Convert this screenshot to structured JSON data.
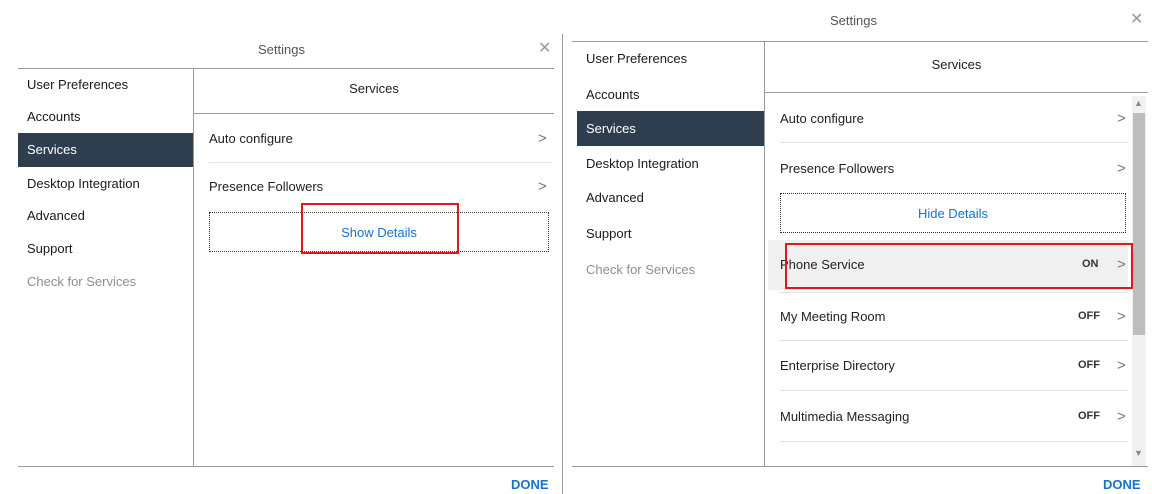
{
  "left_window": {
    "title": "Settings",
    "close_icon": "close-icon",
    "nav": [
      {
        "label": "User Preferences"
      },
      {
        "label": "Accounts"
      },
      {
        "label": "Services",
        "active": true
      },
      {
        "label": "Desktop Integration"
      },
      {
        "label": "Advanced"
      },
      {
        "label": "Support"
      },
      {
        "label": "Check for Services",
        "muted": true
      }
    ],
    "section_title": "Services",
    "rows": [
      {
        "label": "Auto configure",
        "chevron": ">"
      },
      {
        "label": "Presence Followers",
        "chevron": ">"
      }
    ],
    "details_button": "Show Details",
    "done": "DONE"
  },
  "right_window": {
    "title": "Settings",
    "close_icon": "close-icon",
    "nav": [
      {
        "label": "User Preferences"
      },
      {
        "label": "Accounts"
      },
      {
        "label": "Services",
        "active": true
      },
      {
        "label": "Desktop Integration"
      },
      {
        "label": "Advanced"
      },
      {
        "label": "Support"
      },
      {
        "label": "Check for Services",
        "muted": true
      }
    ],
    "section_title": "Services",
    "rows": [
      {
        "label": "Auto configure",
        "state": "",
        "chevron": ">"
      },
      {
        "label": "Presence Followers",
        "state": "",
        "chevron": ">"
      }
    ],
    "details_button": "Hide Details",
    "service_rows": [
      {
        "label": "Phone Service",
        "state": "ON",
        "chevron": ">"
      },
      {
        "label": "My Meeting Room",
        "state": "OFF",
        "chevron": ">"
      },
      {
        "label": "Enterprise Directory",
        "state": "OFF",
        "chevron": ">"
      },
      {
        "label": "Multimedia Messaging",
        "state": "OFF",
        "chevron": ">"
      }
    ],
    "done": "DONE"
  },
  "colors": {
    "active_nav_bg": "#2f3e4e",
    "link_blue": "#1a73c8",
    "highlight_red": "#e0181b"
  }
}
